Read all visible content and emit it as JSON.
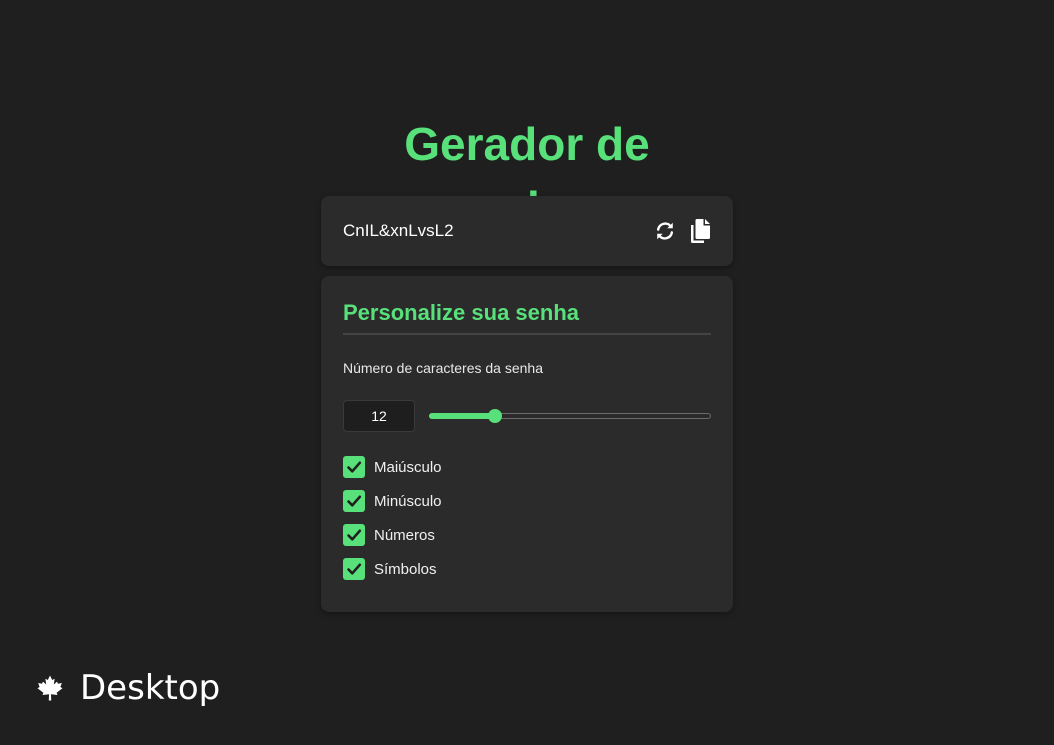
{
  "title": "Gerador de senhas",
  "password": {
    "value": "CnIL&xnLvsL2",
    "refresh_icon": "refresh-icon",
    "copy_icon": "copy-icon"
  },
  "settings": {
    "title": "Personalize sua senha",
    "length_label": "Número de caracteres da senha",
    "length_value": "12",
    "slider_fraction": 0.235,
    "options": [
      {
        "label": "Maiúsculo",
        "checked": true
      },
      {
        "label": "Minúsculo",
        "checked": true
      },
      {
        "label": "Números",
        "checked": true
      },
      {
        "label": "Símbolos",
        "checked": true
      }
    ]
  },
  "footer": {
    "icon": "maple-leaf-icon",
    "label": "Desktop"
  },
  "colors": {
    "accent": "#58e07a",
    "background": "#1f1f1f",
    "card": "#2b2b2b"
  }
}
